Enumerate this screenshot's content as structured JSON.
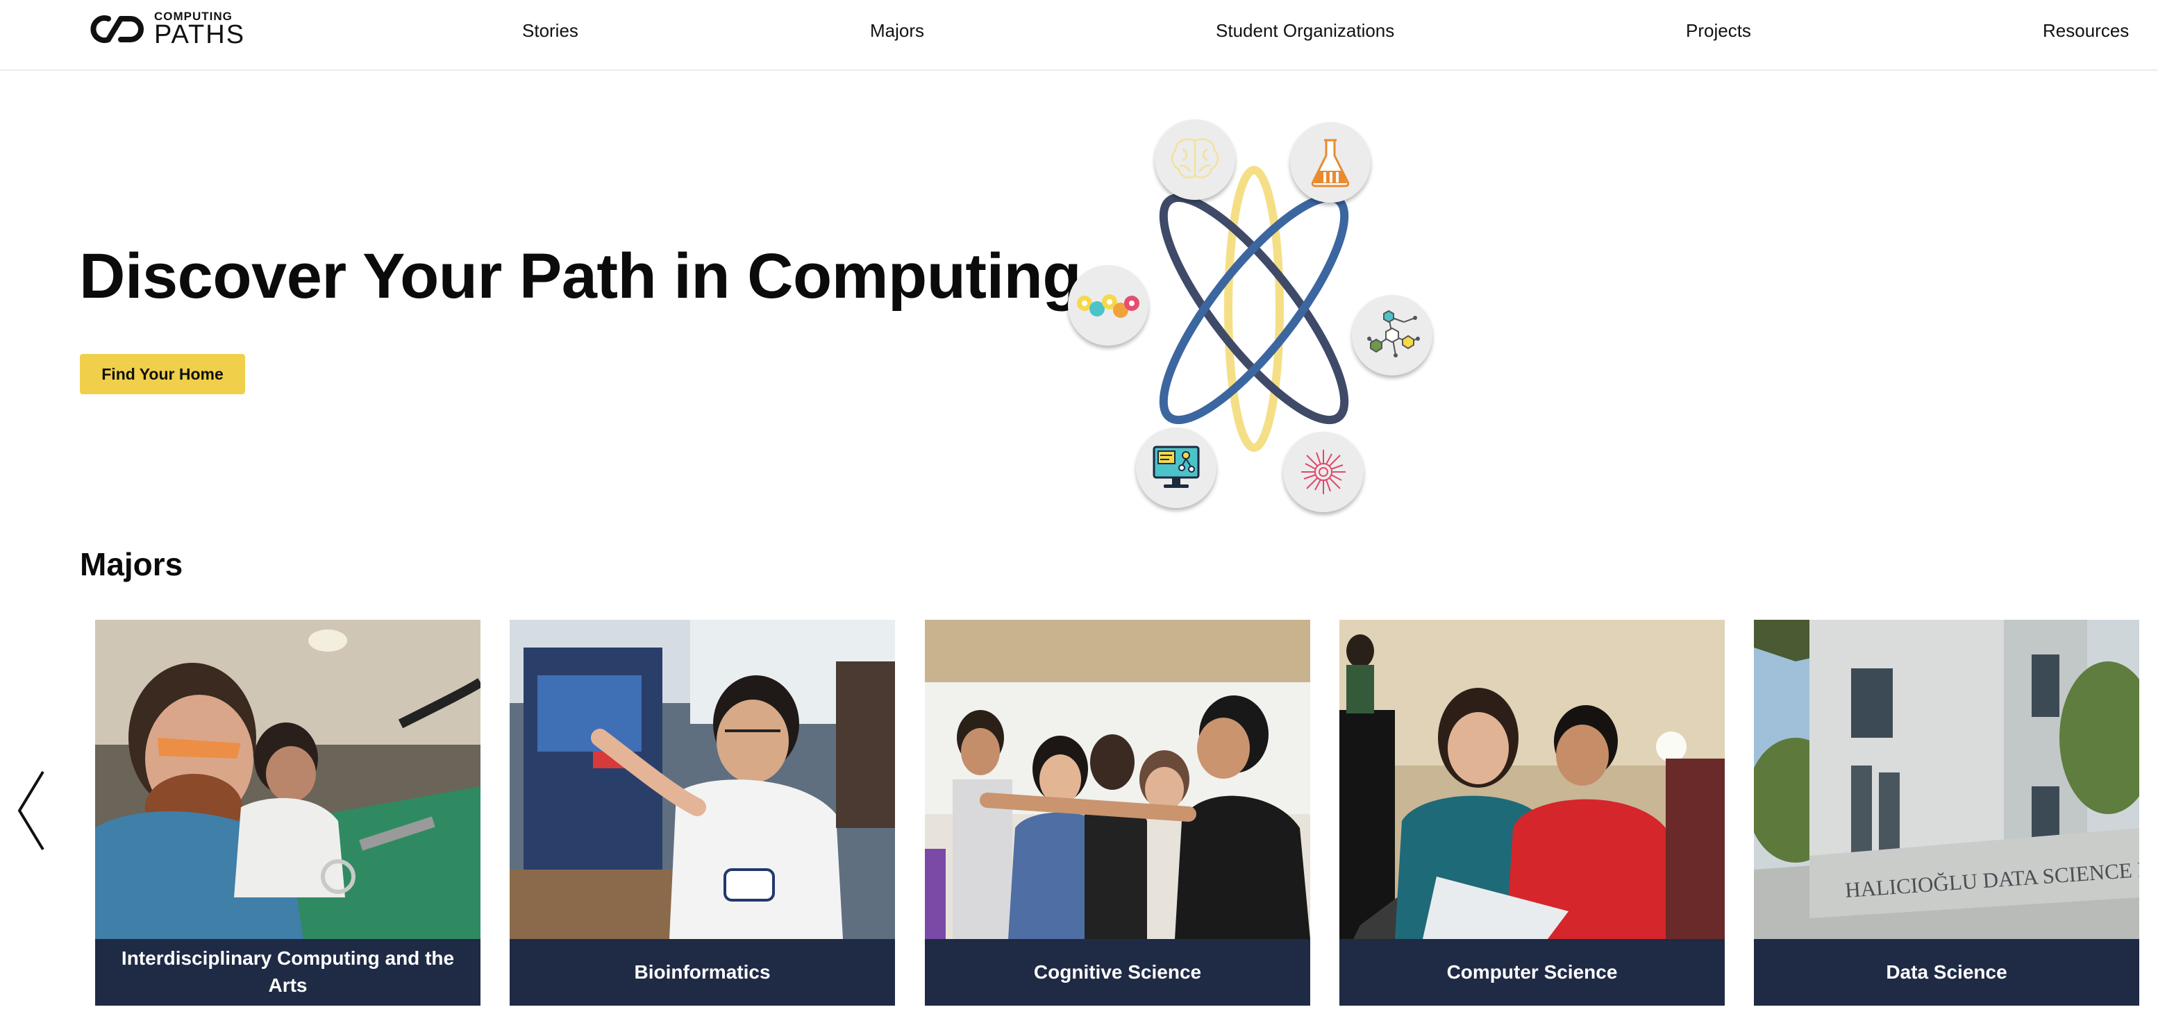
{
  "header": {
    "logo": {
      "top_word": "COMPUTING",
      "bottom_word": "PATHS"
    },
    "nav": [
      "Stories",
      "Majors",
      "Student Organizations",
      "Projects",
      "Resources"
    ]
  },
  "hero": {
    "title": "Discover Your Path in Computing",
    "button_label": "Find Your Home",
    "bubble_icons": [
      "brain-icon",
      "lab-flask-icon",
      "chat-bubbles-icon",
      "molecule-network-icon",
      "computer-monitor-icon",
      "radial-circuit-icon"
    ]
  },
  "majors": {
    "heading": "Majors",
    "cards": [
      {
        "label": "Interdisciplinary Computing and the Arts"
      },
      {
        "label": "Bioinformatics"
      },
      {
        "label": "Cognitive Science"
      },
      {
        "label": "Computer Science"
      },
      {
        "label": "Data Science",
        "photo_sign": "HALICIOĞLU DATA SCIENCE INSTITUTE"
      }
    ]
  },
  "colors": {
    "button": "#f0cf4a",
    "card_label_bg": "#1f2a45",
    "orbit_dark": "#3f4a68",
    "orbit_blue": "#3c66a0",
    "orbit_yellow": "#f5df86"
  }
}
